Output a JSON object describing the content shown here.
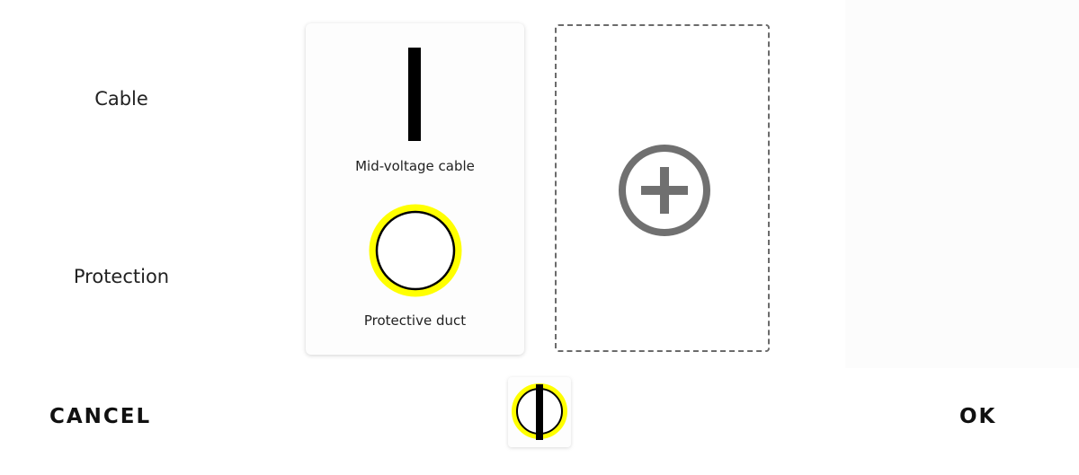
{
  "rows": {
    "cable_label": "Cable",
    "protection_label": "Protection"
  },
  "selection_card": {
    "cable": {
      "name": "Mid-voltage cable",
      "icon": "cable-bar-icon"
    },
    "protection": {
      "name": "Protective duct",
      "icon": "duct-ring-icon"
    }
  },
  "add_slot": {
    "icon": "plus-circle-icon"
  },
  "footer": {
    "cancel_label": "CANCEL",
    "ok_label": "OK",
    "preview_icon": "cable-in-duct-icon"
  },
  "colors": {
    "duct_yellow": "#ffff00",
    "cable_black": "#000000",
    "plus_gray": "#707070",
    "dash_gray": "#6b6b6b"
  }
}
